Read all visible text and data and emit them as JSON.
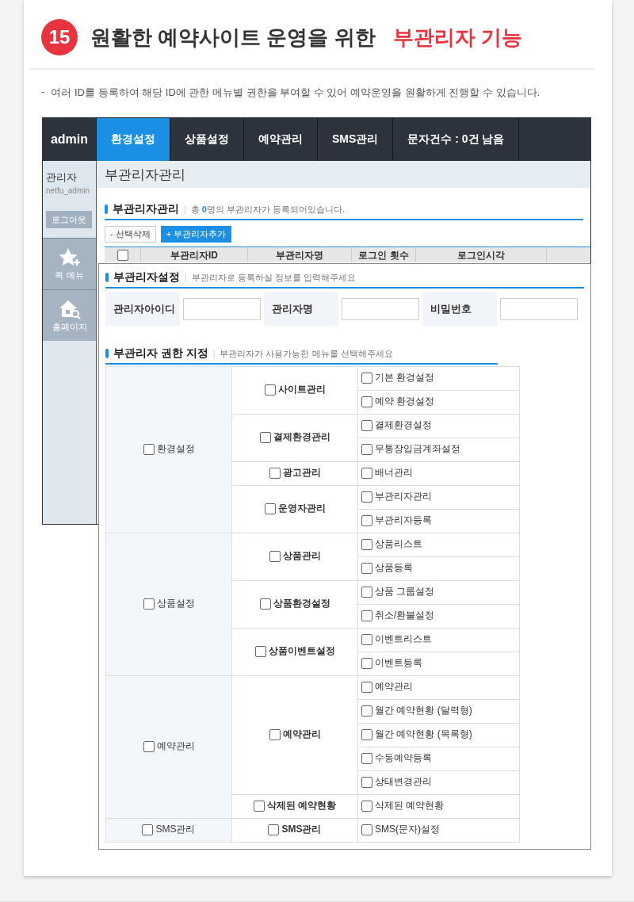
{
  "header": {
    "number": "15",
    "title": "원활한 예약사이트 운영을 위한",
    "highlight": "부관리자 기능"
  },
  "description": {
    "bullet": "-",
    "text": "여러 ID를 등록하여 해당 ID에 관한 메뉴별 권한을 부여할 수 있어 예약운영을 원활하게 진행할 수 있습니다."
  },
  "admin": {
    "logo": "admin",
    "nav": [
      {
        "label": "환경설정",
        "selected": true
      },
      {
        "label": "상품설정",
        "selected": false
      },
      {
        "label": "예약관리",
        "selected": false
      },
      {
        "label": "SMS관리",
        "selected": false
      },
      {
        "label": "문자건수 : 0건 남음",
        "selected": false
      }
    ],
    "sidebar": {
      "role": "관리자",
      "user": "netfu_admin",
      "logout": "로그아웃",
      "quick_links": [
        {
          "kind": "star",
          "label": "퀵 메뉴"
        },
        {
          "kind": "home",
          "label": "홈페이지"
        }
      ]
    },
    "page_title": "부관리자관리",
    "section": {
      "title": "부관리자관리",
      "separator": "|",
      "note": "총 **0**명의 부관리자가 등록되어있습니다."
    },
    "buttons": [
      {
        "kind": "plain",
        "label": "- 선택삭제"
      },
      {
        "kind": "primary",
        "label": "+ 부관리자추가"
      }
    ],
    "table": {
      "select_all": {
        "checked": false
      },
      "columns": [
        "부관리자ID",
        "부관리자명",
        "로그인 횟수",
        "로그인시각"
      ]
    }
  },
  "overlay": {
    "settings": {
      "title": "부관리자설정",
      "separator": "|",
      "note": "부관리자로 등록하실 정보를 입력해주세요",
      "fields": [
        {
          "label": "관리자아이디"
        },
        {
          "label": "관리자명"
        },
        {
          "label": "비밀번호"
        }
      ]
    },
    "permissions": {
      "title": "부관리자 권한 지정",
      "separator": "|",
      "note": "부관리자가 사용가능한 메뉴를 선택해주세요",
      "groups": [
        {
          "label": "환경설정",
          "checked": false,
          "children": [
            {
              "label": "사이트관리",
              "checked": false,
              "children": [
                {
                  "label": "기본 환경설정",
                  "checked": false
                },
                {
                  "label": "예약 환경설정",
                  "checked": false
                }
              ]
            },
            {
              "label": "결제환경관리",
              "checked": false,
              "children": [
                {
                  "label": "결제환경설정",
                  "checked": false
                },
                {
                  "label": "무통장입금계좌설정",
                  "checked": false
                }
              ]
            },
            {
              "label": "광고관리",
              "checked": false,
              "children": [
                {
                  "label": "배너관리",
                  "checked": false
                }
              ]
            },
            {
              "label": "운영자관리",
              "checked": false,
              "children": [
                {
                  "label": "부관리자관리",
                  "checked": false
                },
                {
                  "label": "부관리자등록",
                  "checked": false
                }
              ]
            }
          ]
        },
        {
          "label": "상품설정",
          "checked": false,
          "children": [
            {
              "label": "상품관리",
              "checked": false,
              "children": [
                {
                  "label": "상품리스트",
                  "checked": false
                },
                {
                  "label": "상품등록",
                  "checked": false
                }
              ]
            },
            {
              "label": "상품환경설정",
              "checked": false,
              "children": [
                {
                  "label": "상품 그룹설정",
                  "checked": false
                },
                {
                  "label": "취소/환불설정",
                  "checked": false
                }
              ]
            },
            {
              "label": "상품이벤트설정",
              "checked": false,
              "children": [
                {
                  "label": "이벤트리스트",
                  "checked": false
                },
                {
                  "label": "이벤트등록",
                  "checked": false
                }
              ]
            }
          ]
        },
        {
          "label": "예약관리",
          "checked": false,
          "children": [
            {
              "label": "예약관리",
              "checked": false,
              "children": [
                {
                  "label": "예약관리",
                  "checked": false
                },
                {
                  "label": "월간 예약현황 (달력형)",
                  "checked": false
                },
                {
                  "label": "월간 예약현황 (목록형)",
                  "checked": false
                },
                {
                  "label": "수동예약등록",
                  "checked": false
                },
                {
                  "label": "상태변경관리",
                  "checked": false
                }
              ]
            },
            {
              "label": "삭제된 예약현황",
              "checked": false,
              "children": [
                {
                  "label": "삭제된 예약현황",
                  "checked": false
                }
              ]
            }
          ]
        },
        {
          "label": "SMS관리",
          "checked": false,
          "children": [
            {
              "label": "SMS관리",
              "checked": false,
              "children": [
                {
                  "label": "SMS(문자)설정",
                  "checked": false
                }
              ]
            }
          ]
        }
      ]
    }
  }
}
